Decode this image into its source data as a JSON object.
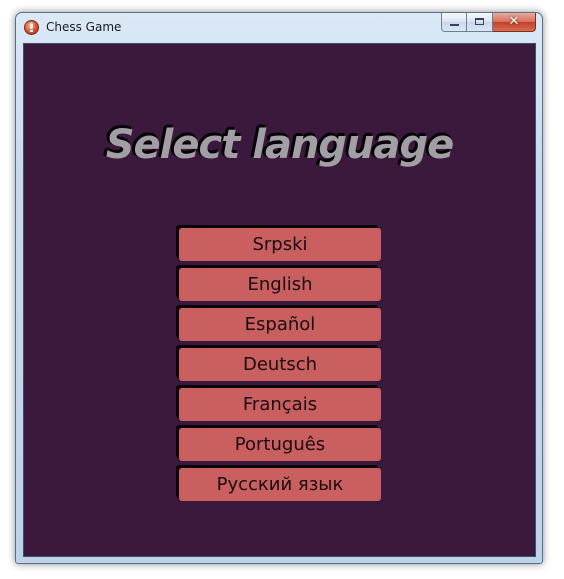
{
  "window": {
    "title": "Chess Game",
    "app_icon": "warning-exclamation-icon",
    "controls": {
      "minimize": "minimize-icon",
      "maximize": "maximize-icon",
      "close": "✕"
    }
  },
  "main": {
    "heading": "Select language",
    "languages": [
      {
        "label": "Srpski"
      },
      {
        "label": "English"
      },
      {
        "label": "Español"
      },
      {
        "label": "Deutsch"
      },
      {
        "label": "Français"
      },
      {
        "label": "Português"
      },
      {
        "label": "Русский язык"
      }
    ]
  },
  "colors": {
    "background": "#3b193d",
    "button": "#c95f5e",
    "heading": "#a19ea4"
  }
}
